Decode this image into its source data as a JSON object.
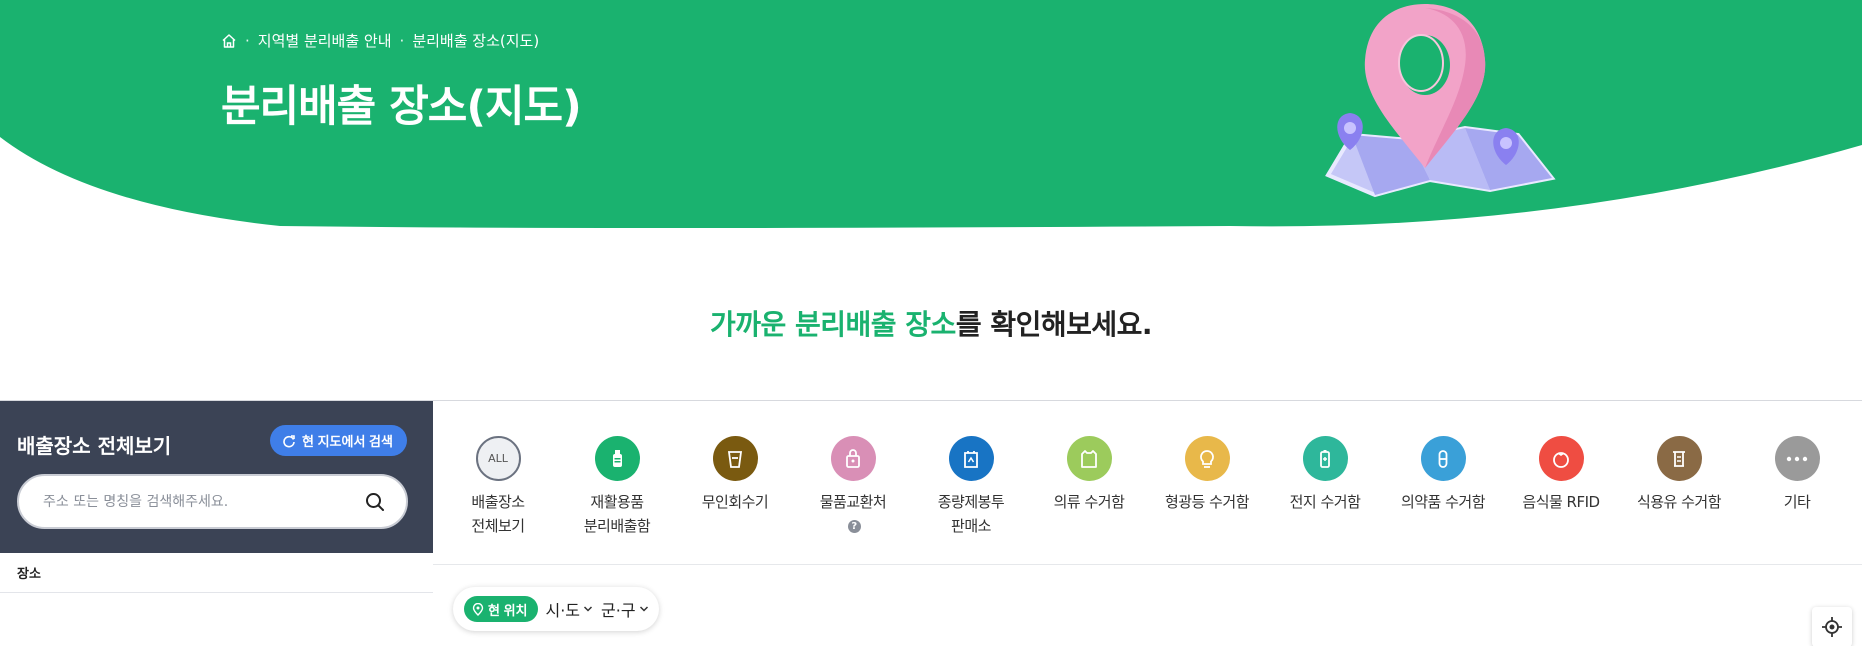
{
  "breadcrumb": {
    "items": [
      "지역별 분리배출 안내",
      "분리배출 장소(지도)"
    ],
    "separator": "·"
  },
  "page": {
    "title": "분리배출 장소(지도)",
    "headline_accent": "가까운 분리배출 장소",
    "headline_rest": "를 확인해보세요."
  },
  "left_panel": {
    "title": "배출장소 전체보기",
    "map_search_button": "현 지도에서 검색",
    "search_placeholder": "주소 또는 명칭을 검색해주세요.",
    "column_header": "장소"
  },
  "categories": [
    {
      "id": "all",
      "lines": [
        "배출장소",
        "전체보기"
      ],
      "icon_text": "ALL",
      "color": "#eef0f3",
      "icon": "all-icon"
    },
    {
      "id": "recycle-box",
      "lines": [
        "재활용품",
        "분리배출함"
      ],
      "color": "#1ab26f",
      "icon": "bottle-icon"
    },
    {
      "id": "vending",
      "lines": [
        "무인회수기"
      ],
      "color": "#7a5a10",
      "icon": "cup-icon"
    },
    {
      "id": "exchange",
      "lines": [
        "물품교환처"
      ],
      "color": "#d98fb6",
      "icon": "bag-icon",
      "help": "?"
    },
    {
      "id": "bag-shop",
      "lines": [
        "종량제봉투",
        "판매소"
      ],
      "color": "#1874c4",
      "icon": "recycle-bag-icon"
    },
    {
      "id": "clothes",
      "lines": [
        "의류 수거함"
      ],
      "color": "#9ccb5c",
      "icon": "shirt-icon"
    },
    {
      "id": "lamp",
      "lines": [
        "형광등 수거함"
      ],
      "color": "#e8b84a",
      "icon": "bulb-icon"
    },
    {
      "id": "battery",
      "lines": [
        "전지 수거함"
      ],
      "color": "#2eb79b",
      "icon": "battery-icon"
    },
    {
      "id": "medicine",
      "lines": [
        "의약품 수거함"
      ],
      "color": "#3aa0d8",
      "icon": "pill-icon"
    },
    {
      "id": "food",
      "lines": [
        "음식물 RFID"
      ],
      "color": "#ef4d42",
      "icon": "tomato-icon"
    },
    {
      "id": "oil",
      "lines": [
        "식용유 수거함"
      ],
      "color": "#8a6a45",
      "icon": "oil-icon"
    },
    {
      "id": "etc",
      "lines": [
        "기타"
      ],
      "color": "#9a9a9a",
      "icon": "more-icon"
    }
  ],
  "location_filter": {
    "current_location": "현 위치",
    "province": "시·도",
    "district": "군·구"
  },
  "colors": {
    "brand_green": "#1ab26f",
    "panel_dark": "#3b4355",
    "button_blue": "#3f7ee8"
  }
}
